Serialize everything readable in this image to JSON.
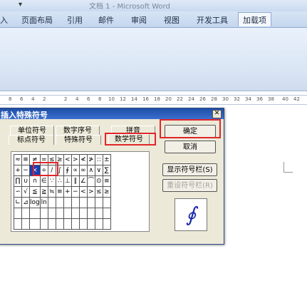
{
  "window": {
    "title": "文档 1 - Microsoft Word"
  },
  "ribbon": {
    "tabs": [
      {
        "label": "入"
      },
      {
        "label": "页面布局"
      },
      {
        "label": "引用"
      },
      {
        "label": "邮件"
      },
      {
        "label": "审阅"
      },
      {
        "label": "视图"
      },
      {
        "label": "开发工具"
      },
      {
        "label": "加载项"
      }
    ],
    "active_tab": "加载项"
  },
  "ruler": {
    "ticks": [
      "8",
      "6",
      "4",
      "2",
      "2",
      "4",
      "6",
      "8",
      "10",
      "12",
      "14",
      "16",
      "18",
      "20",
      "22",
      "24",
      "26",
      "28",
      "30",
      "32",
      "34",
      "36",
      "38",
      "40",
      "42"
    ]
  },
  "dialog": {
    "title": "插入特殊符号",
    "close_glyph": "✕",
    "tabs_row1": [
      "单位符号",
      "数字序号",
      "拼音"
    ],
    "tabs_row2": [
      "标点符号",
      "特殊符号",
      "数学符号"
    ],
    "selected_tab": "数学符号",
    "symbol_rows": [
      [
        "≈",
        "≡",
        "≠",
        "=",
        "≤",
        "≥",
        "<",
        ">",
        "≮",
        "≯",
        "::",
        "±"
      ],
      [
        "+",
        "−",
        "×",
        "÷",
        "/",
        "∫",
        "∮",
        "∝",
        "∞",
        "∧",
        "∨",
        "∑"
      ],
      [
        "∏",
        "∪",
        "∩",
        "∈",
        "∵",
        "∴",
        "⊥",
        "∥",
        "∠",
        "⌒",
        "⊙",
        "≌"
      ],
      [
        "∽",
        "√",
        "≦",
        "≧",
        "≒",
        "≡",
        "+",
        "−",
        "<",
        ">",
        "≤",
        "≥"
      ],
      [
        "∟",
        "⊿",
        "log",
        "ln",
        "",
        "",
        "",
        "",
        "",
        "",
        "",
        ""
      ],
      [
        "",
        "",
        "",
        "",
        "",
        "",
        "",
        "",
        "",
        "",
        "",
        ""
      ],
      [
        "",
        "",
        "",
        "",
        "",
        "",
        "",
        "",
        "",
        "",
        "",
        ""
      ]
    ],
    "selected_symbol": "×",
    "buttons": {
      "ok": "确定",
      "cancel": "取消",
      "show_bar": "显示符号栏(S)",
      "reset_bar": "重设符号栏(R)"
    },
    "preview_symbol": "∮"
  },
  "colors": {
    "dialog_title_bar": "#1e4fa6",
    "highlight": "#1c3fb4",
    "annotation_red": "#e0262b"
  }
}
